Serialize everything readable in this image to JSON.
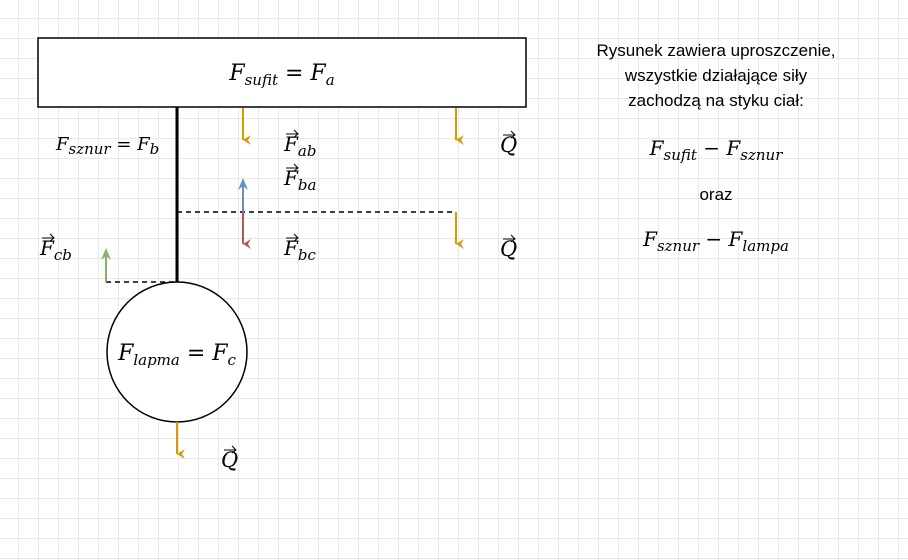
{
  "ceiling": {
    "label_main": "F",
    "label_sub": "sufit",
    "label_rest": " = F",
    "label_rest_sub": "a"
  },
  "cord": {
    "label_main": "F",
    "label_sub": "sznur",
    "label_rest": " = F",
    "label_rest_sub": "b"
  },
  "lamp": {
    "label_main": "F",
    "label_sub": "lapma",
    "label_rest": " = F",
    "label_rest_sub": "c"
  },
  "forces": {
    "ab": {
      "main": "F",
      "sub": "ab"
    },
    "ba": {
      "main": "F",
      "sub": "ba"
    },
    "bc": {
      "main": "F",
      "sub": "bc"
    },
    "cb": {
      "main": "F",
      "sub": "cb"
    },
    "q": "Q"
  },
  "note": {
    "lines": [
      "Rysunek zawiera uproszczenie,",
      "wszystkie działające siły",
      "zachodzą na styku ciał:"
    ],
    "pair1": {
      "a": "F",
      "a_sub": "sufit",
      "op": " − F",
      "b_sub": "sznur"
    },
    "conj": "oraz",
    "pair2": {
      "a": "F",
      "a_sub": "sznur",
      "op": " − F",
      "b_sub": "lampa"
    }
  },
  "colors": {
    "gravity": "#d79b00",
    "up_blue": "#6c8ebf",
    "down_red": "#b85450",
    "up_green": "#82b366"
  }
}
